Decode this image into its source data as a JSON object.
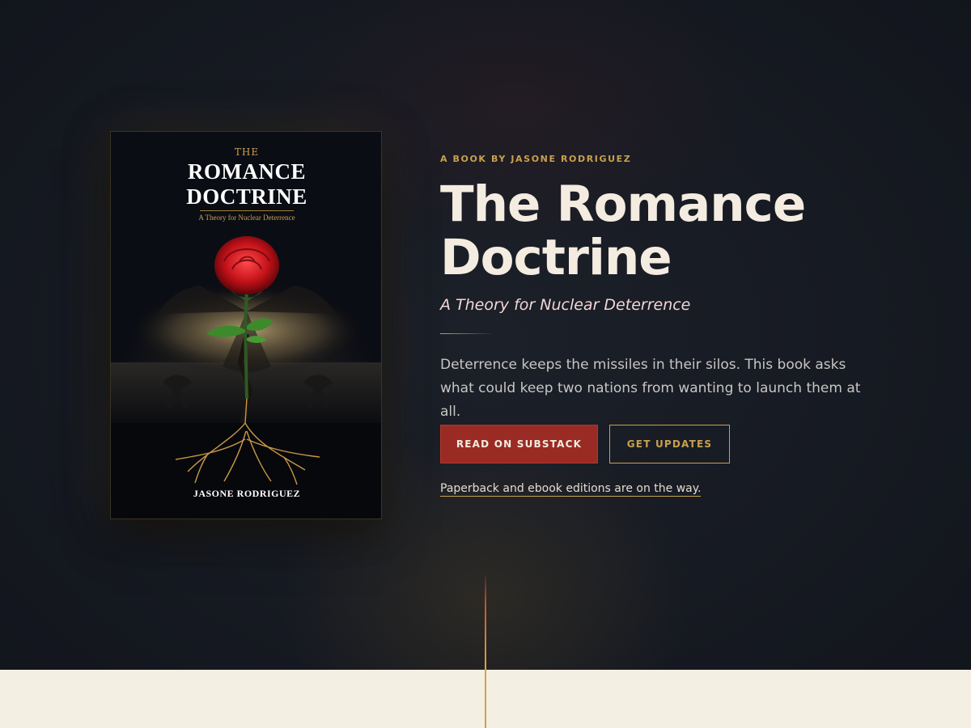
{
  "cover": {
    "the": "THE",
    "title_line1": "ROMANCE",
    "title_line2": "DOCTRINE",
    "subtitle": "A Theory for Nuclear Deterrence",
    "author": "JASONE RODRIGUEZ"
  },
  "hero": {
    "eyebrow": "A BOOK BY JASONE RODRIGUEZ",
    "title_line1": "The Romance",
    "title_line2": "Doctrine",
    "subtitle": "A Theory for Nuclear Deterrence",
    "description": "Deterrence keeps the missiles in their silos. This book asks what could keep two nations from wanting to launch them at all.",
    "primary_button": "READ ON SUBSTACK",
    "secondary_button": "GET UPDATES",
    "note_link": "Paperback and ebook editions are on the way."
  },
  "colors": {
    "accent_gold": "#c9a14e",
    "primary_red": "#9a2b24",
    "background_dark": "#141820",
    "cream": "#f4efe3"
  }
}
